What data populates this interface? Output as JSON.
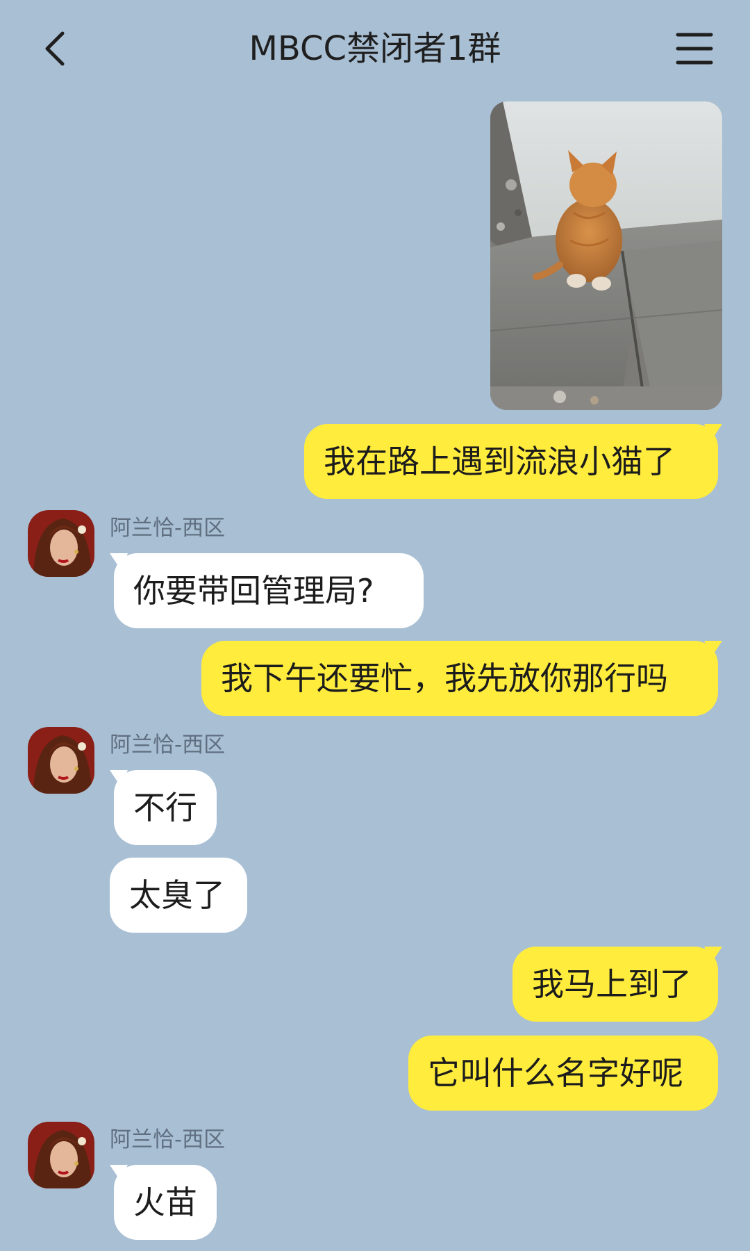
{
  "header": {
    "title": "MBCC禁闭者1群",
    "back_icon": "chevron-left-icon",
    "menu_icon": "hamburger-menu-icon"
  },
  "colors": {
    "background": "#a9bfd4",
    "my_bubble": "#ffec3d",
    "their_bubble": "#ffffff",
    "sender_name": "#5f6f80"
  },
  "messages": [
    {
      "from": "me",
      "type": "image",
      "content": "orange kitten photo"
    },
    {
      "from": "me",
      "type": "text",
      "text": "我在路上遇到流浪小猫了"
    },
    {
      "from": "them",
      "sender": "阿兰恰-西区",
      "type": "text",
      "text": "你要带回管理局?"
    },
    {
      "from": "me",
      "type": "text",
      "text": "我下午还要忙，我先放你那行吗"
    },
    {
      "from": "them",
      "sender": "阿兰恰-西区",
      "type": "text",
      "text": "不行"
    },
    {
      "from": "them",
      "type": "text",
      "text": "太臭了"
    },
    {
      "from": "me",
      "type": "text",
      "text": "我马上到了"
    },
    {
      "from": "me",
      "type": "text",
      "text": "它叫什么名字好呢"
    },
    {
      "from": "them",
      "sender": "阿兰恰-西区",
      "type": "text",
      "text": "火苗"
    }
  ]
}
